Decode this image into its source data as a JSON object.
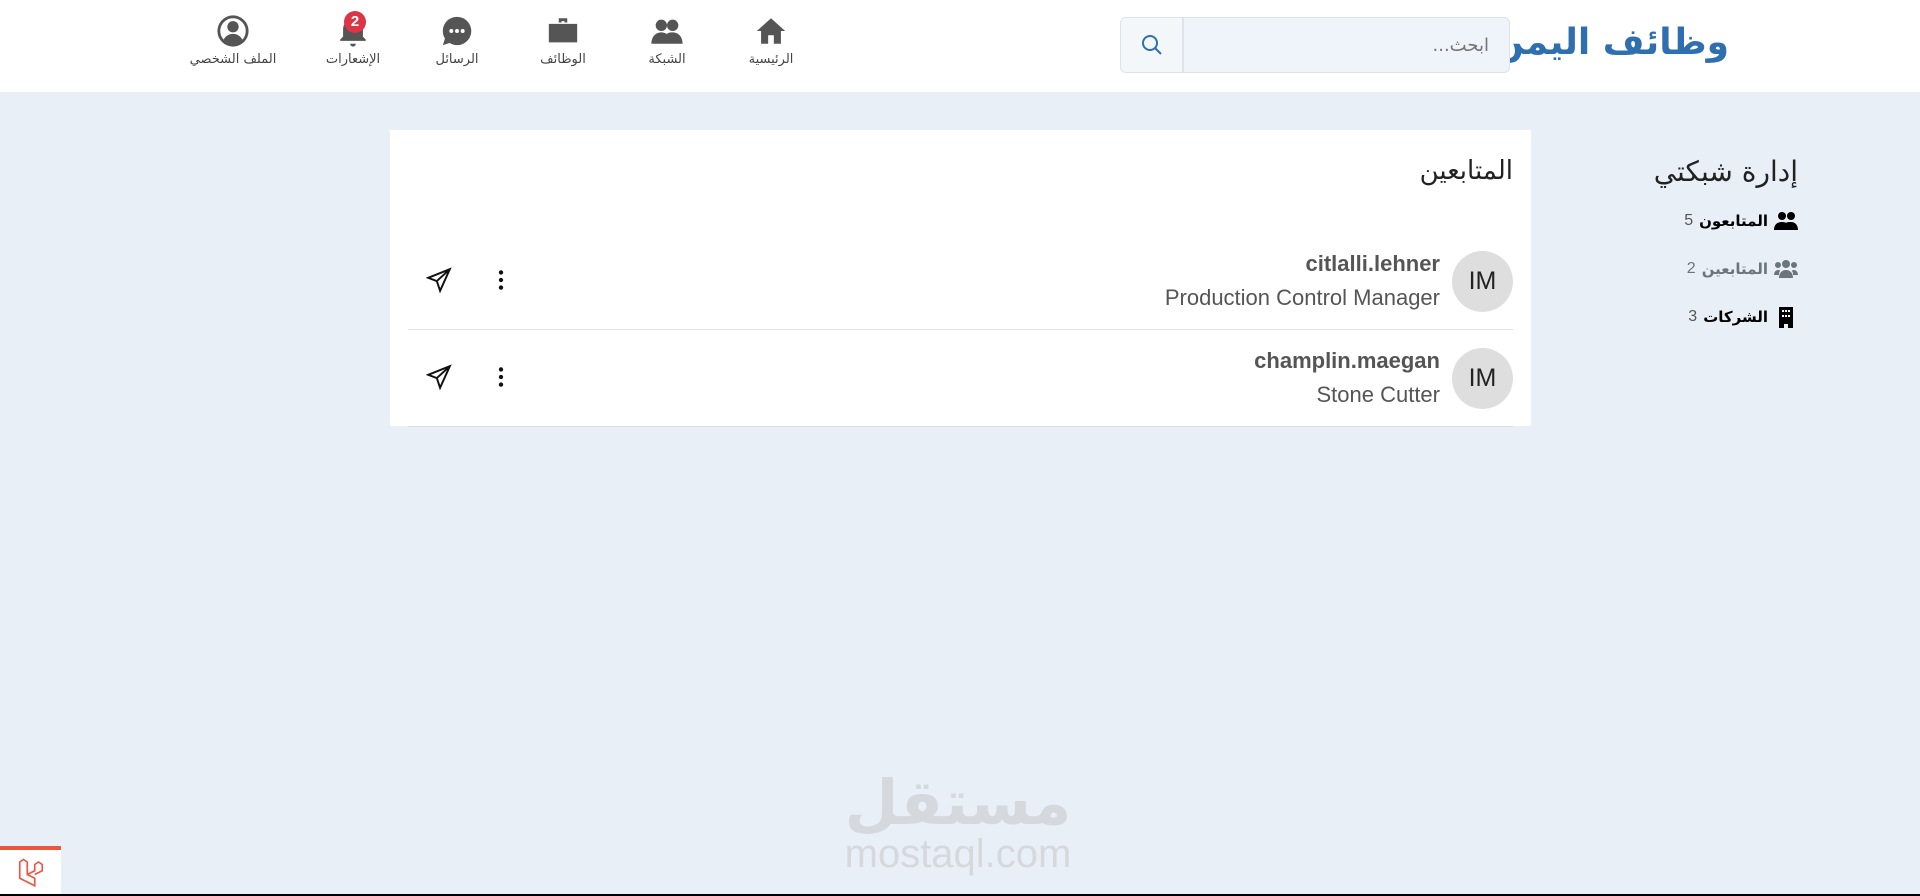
{
  "header": {
    "logo": "وظائف اليمن",
    "search_placeholder": "ابحث...",
    "nav": [
      {
        "label": "الرئيسية",
        "icon": "home-icon"
      },
      {
        "label": "الشبكة",
        "icon": "users-icon"
      },
      {
        "label": "الوظائف",
        "icon": "briefcase-icon"
      },
      {
        "label": "الرسائل",
        "icon": "chat-icon"
      },
      {
        "label": "الإشعارات",
        "icon": "bell-icon",
        "badge": "2"
      },
      {
        "label": "الملف الشخصي",
        "icon": "user-circle-icon"
      }
    ]
  },
  "sidebar": {
    "title": "إدارة شبكتي",
    "items": [
      {
        "label": "المتابعون",
        "count": "5"
      },
      {
        "label": "المتابعين",
        "count": "2"
      },
      {
        "label": "الشركات",
        "count": "3"
      }
    ]
  },
  "main": {
    "title": "المتابعين",
    "rows": [
      {
        "initials": "IM",
        "name": "citlalli.lehner",
        "title": "Production Control Manager"
      },
      {
        "initials": "IM",
        "name": "champlin.maegan",
        "title": "Stone Cutter"
      }
    ]
  },
  "watermark": {
    "ar": "مستقل",
    "en": "mostaql.com"
  },
  "colors": {
    "brand": "#2f6fb0",
    "background": "#e8eff7",
    "badge": "#dc3545"
  }
}
